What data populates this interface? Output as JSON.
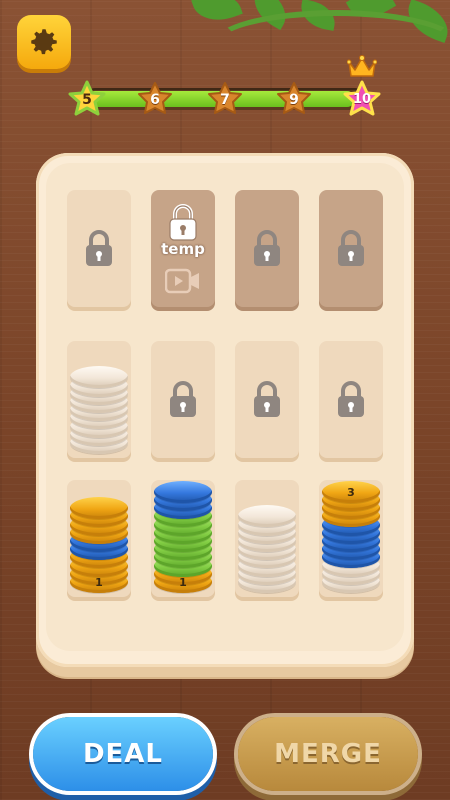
{
  "colors": {
    "gold": "#f7b51d",
    "blue": "#3d86e6",
    "green": "#8fd84a",
    "white": "#f4eadf",
    "board": "#fbecd6"
  },
  "level_progress": {
    "current_star": "5",
    "stars": [
      "6",
      "7",
      "9"
    ],
    "goal_star": "10",
    "fill_fraction": 0.97
  },
  "slots": [
    {
      "type": "locked"
    },
    {
      "type": "locked-temp",
      "label": "temp"
    },
    {
      "type": "locked"
    },
    {
      "type": "locked"
    },
    {
      "type": "open",
      "stack": [
        {
          "color": "white",
          "count": 9
        }
      ]
    },
    {
      "type": "locked"
    },
    {
      "type": "locked"
    },
    {
      "type": "locked"
    },
    {
      "type": "open",
      "stack": [
        {
          "color": "gold",
          "count": 4
        },
        {
          "color": "blue",
          "count": 2
        },
        {
          "color": "gold",
          "count": 4
        }
      ],
      "count_label": "1"
    },
    {
      "type": "open",
      "stack": [
        {
          "color": "gold",
          "count": 2
        },
        {
          "color": "green",
          "count": 7
        },
        {
          "color": "blue",
          "count": 3
        }
      ],
      "count_label": "1"
    },
    {
      "type": "open",
      "stack": [
        {
          "color": "white",
          "count": 9
        }
      ]
    },
    {
      "type": "open",
      "stack": [
        {
          "color": "white",
          "count": 3
        },
        {
          "color": "blue",
          "count": 5
        },
        {
          "color": "gold",
          "count": 4
        }
      ],
      "count_label": "3"
    }
  ],
  "buttons": {
    "deal": "DEAL",
    "merge": "MERGE"
  }
}
